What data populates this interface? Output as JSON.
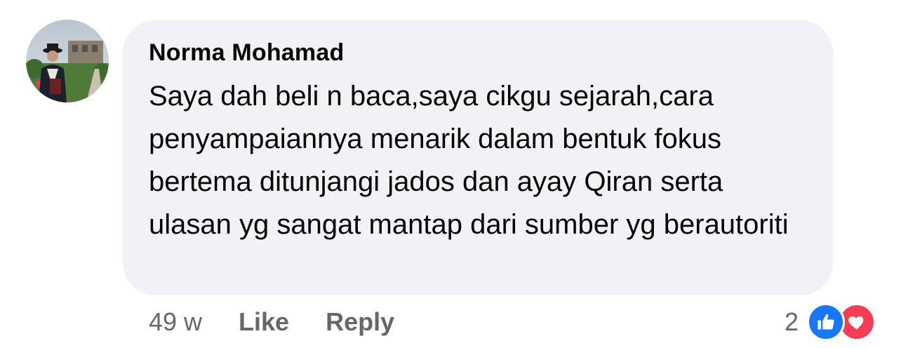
{
  "comment": {
    "author": "Norma Mohamad",
    "text": "Saya dah beli n baca,saya cikgu sejarah,cara penyampaiannya menarik dalam bentuk fokus bertema ditunjangi jados dan ayay Qiran serta ulasan yg sangat mantap dari sumber yg berautoriti",
    "timestamp": "49 w",
    "like_label": "Like",
    "reply_label": "Reply",
    "reaction_count": "2",
    "reaction_icons": [
      "like-icon",
      "love-icon"
    ]
  },
  "colors": {
    "bubble_bg": "#f0f2f5",
    "meta_text": "#65676b",
    "like_blue": "#1877f2",
    "love_red": "#f33e58"
  }
}
